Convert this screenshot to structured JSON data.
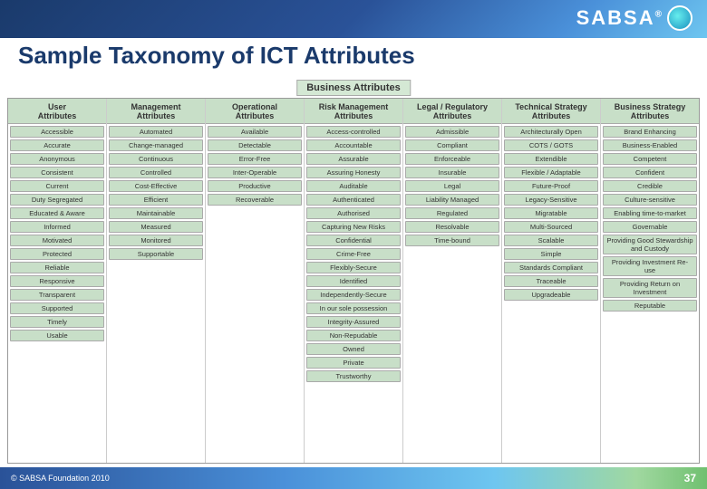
{
  "header": {
    "title": "Sample Taxonomy of ICT Attributes",
    "logo_text": "SABSA",
    "logo_reg": "®"
  },
  "business_attributes_label": "Business Attributes",
  "columns": [
    {
      "id": "user",
      "header": "User\nAttributes",
      "items": [
        "Accessible",
        "Accurate",
        "Anonymous",
        "Consistent",
        "Current",
        "Duty Segregated",
        "Educated & Aware",
        "Informed",
        "Motivated",
        "Protected",
        "Reliable",
        "Responsive",
        "Transparent",
        "Supported",
        "Timely",
        "Usable"
      ]
    },
    {
      "id": "management",
      "header": "Management\nAttributes",
      "items": [
        "Automated",
        "Change-managed",
        "Continuous",
        "Controlled",
        "Cost-Effective",
        "Efficient",
        "Maintainable",
        "Measured",
        "Monitored",
        "Supportable"
      ]
    },
    {
      "id": "operational",
      "header": "Operational\nAttributes",
      "items": [
        "Available",
        "Detectable",
        "Error-Free",
        "Inter-Operable",
        "Productive",
        "Recoverable"
      ]
    },
    {
      "id": "risk",
      "header": "Risk Management\nAttributes",
      "items": [
        "Access-controlled",
        "Accountable",
        "Assurable",
        "Assuring Honesty",
        "Auditable",
        "Authenticated",
        "Authorised",
        "Capturing New Risks",
        "Confidential",
        "Crime-Free",
        "Flexibly-Secure",
        "Identified",
        "Independently-Secure",
        "In our sole possession",
        "Integrity-Assured",
        "Non-Repudable",
        "Owned",
        "Private",
        "Trustworthy"
      ]
    },
    {
      "id": "legal",
      "header": "Legal / Regulatory\nAttributes",
      "items": [
        "Admissible",
        "Compliant",
        "Enforceable",
        "Insurable",
        "Legal",
        "Liability Managed",
        "Regulated",
        "Resolvable",
        "Time-bound"
      ]
    },
    {
      "id": "technical",
      "header": "Technical Strategy\nAttributes",
      "items": [
        "Architecturally Open",
        "COTS / GOTS",
        "Extendible",
        "Flexible / Adaptable",
        "Future-Proof",
        "Legacy-Sensitive",
        "Migratable",
        "Multi-Sourced",
        "Scalable",
        "Simple",
        "Standards Compliant",
        "Traceable",
        "Upgradeable"
      ]
    },
    {
      "id": "business_strategy",
      "header": "Business Strategy\nAttributes",
      "items": [
        "Brand Enhancing",
        "Business-Enabled",
        "Competent",
        "Confident",
        "Credible",
        "Culture-sensitive",
        "Enabling time-to-market",
        "Governable",
        "Providing Good Stewardship and Custody",
        "Providing Investment Re-use",
        "Providing Return on Investment",
        "Reputable"
      ]
    }
  ],
  "footer": {
    "copyright": "© SABSA Foundation 2010",
    "page_number": "37"
  }
}
